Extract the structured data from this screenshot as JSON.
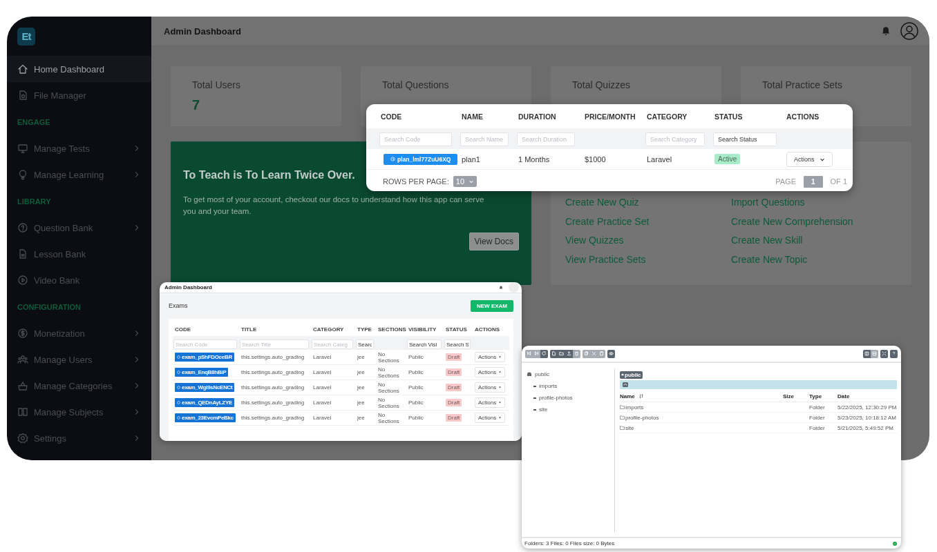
{
  "sidebar": {
    "logo": "Et",
    "items": [
      {
        "kind": "item",
        "label": "Home Dashboard",
        "selected": true,
        "submenu": false
      },
      {
        "kind": "item",
        "label": "File Manager",
        "selected": false,
        "submenu": false
      },
      {
        "kind": "section",
        "label": "ENGAGE"
      },
      {
        "kind": "item",
        "label": "Manage Tests",
        "selected": false,
        "submenu": true
      },
      {
        "kind": "item",
        "label": "Manage Learning",
        "selected": false,
        "submenu": true
      },
      {
        "kind": "section",
        "label": "LIBRARY"
      },
      {
        "kind": "item",
        "label": "Question Bank",
        "selected": false,
        "submenu": true
      },
      {
        "kind": "item",
        "label": "Lesson Bank",
        "selected": false,
        "submenu": false
      },
      {
        "kind": "item",
        "label": "Video Bank",
        "selected": false,
        "submenu": false
      },
      {
        "kind": "section",
        "label": "CONFIGURATION"
      },
      {
        "kind": "item",
        "label": "Monetization",
        "selected": false,
        "submenu": true
      },
      {
        "kind": "item",
        "label": "Manage Users",
        "selected": false,
        "submenu": true
      },
      {
        "kind": "item",
        "label": "Manage Categories",
        "selected": false,
        "submenu": true
      },
      {
        "kind": "item",
        "label": "Manage Subjects",
        "selected": false,
        "submenu": true
      },
      {
        "kind": "item",
        "label": "Settings",
        "selected": false,
        "submenu": true
      }
    ]
  },
  "header": {
    "title": "Admin Dashboard"
  },
  "stats": [
    {
      "label": "Total Users",
      "value": "7"
    },
    {
      "label": "Total Questions"
    },
    {
      "label": "Total Quizzes"
    },
    {
      "label": "Total Practice Sets"
    }
  ],
  "banner": {
    "title": "To Teach is To Learn Twice Over.",
    "text": "To get most of your account, checkout our docs to understand how this app can serve you and your team.",
    "button": "View Docs"
  },
  "quick_links": [
    "Create New Quiz",
    "Import Questions",
    "Create Practice Set",
    "Create New Comprehension",
    "View Quizzes",
    "Create New Skill",
    "View Practice Sets",
    "Create New Topic"
  ],
  "plans_table": {
    "columns": [
      {
        "label": "CODE",
        "filter": {
          "placeholder": "Search Code"
        }
      },
      {
        "label": "NAME",
        "filter": {
          "placeholder": "Search Name"
        }
      },
      {
        "label": "DURATION",
        "filter": {
          "placeholder": "Search Duration"
        }
      },
      {
        "label": "PRICE/MONTH"
      },
      {
        "label": "CATEGORY",
        "filter": {
          "placeholder": "Search Category"
        }
      },
      {
        "label": "STATUS",
        "filter": {
          "value": "Search Status"
        }
      },
      {
        "label": "ACTIONS"
      }
    ],
    "rows": [
      {
        "code": "plan_lml77ZuU6XQ",
        "name": "plan1",
        "duration": "1 Months",
        "price": "$1000",
        "category": "Laravel",
        "status": "Active",
        "color": "#a8ecc9",
        "action": "Actions"
      }
    ],
    "footer": {
      "rows_label": "ROWS PER PAGE:",
      "rows_value": "10",
      "page_label": "PAGE",
      "page": "1",
      "page_total": "OF 1"
    }
  },
  "exams_window": {
    "title": "Admin Dashboard",
    "heading": "Exams",
    "new_button": "NEW EXAM",
    "columns": [
      {
        "label": "CODE",
        "filter": {
          "placeholder": "Search Code"
        }
      },
      {
        "label": "TITLE",
        "filter": {
          "placeholder": "Search Title"
        }
      },
      {
        "label": "CATEGORY",
        "filter": {
          "placeholder": "Search Categ"
        }
      },
      {
        "label": "TYPE",
        "filter": {
          "value": "Searc"
        }
      },
      {
        "label": "SECTIONS"
      },
      {
        "label": "VISIBILITY",
        "filter": {
          "value": "Search Visi"
        }
      },
      {
        "label": "STATUS",
        "filter": {
          "value": "Search S"
        }
      },
      {
        "label": "ACTIONS"
      }
    ],
    "rows": [
      {
        "code": "exam_pShFDOceBR",
        "title": "this.settings.auto_grading",
        "category": "Laravel",
        "type": "jee",
        "sections": "No Sections",
        "visibility": "Public",
        "status": "Draft",
        "color": "#f9c9c9",
        "action": "Actions"
      },
      {
        "code": "exam_EnqB8hBiP",
        "title": "this.settings.auto_grading",
        "category": "Laravel",
        "type": "jee",
        "sections": "No Sections",
        "visibility": "Public",
        "status": "Draft",
        "color": "#f9c9c9",
        "action": "Actions"
      },
      {
        "code": "exam_WgI9sNcENCt",
        "title": "this.settings.auto_grading",
        "category": "Laravel",
        "type": "jee",
        "sections": "No Sections",
        "visibility": "Public",
        "status": "Draft",
        "color": "#f9c9c9",
        "action": "Actions"
      },
      {
        "code": "exam_QEDnAyLZYE",
        "title": "this.settings.auto_grading",
        "category": "Laravel",
        "type": "jee",
        "sections": "No Sections",
        "visibility": "Public",
        "status": "Draft",
        "color": "#f9c9c9",
        "action": "Actions"
      },
      {
        "code": "exam_23EvcmPeBkc",
        "title": "this.settings.auto_grading",
        "category": "Laravel",
        "type": "jee",
        "sections": "No Sections",
        "visibility": "Public",
        "status": "Draft",
        "color": "#f9c9c9",
        "action": "Actions"
      }
    ]
  },
  "file_manager": {
    "toolbar": {
      "left": [
        [
          {
            "disabled": true
          },
          {
            "disabled": true
          },
          {
            "disabled": false
          }
        ],
        [
          {
            "disabled": false
          },
          {
            "disabled": false
          },
          {
            "disabled": false
          },
          {
            "disabled": true
          }
        ],
        [
          {
            "disabled": true
          },
          {
            "disabled": true
          },
          {
            "disabled": true
          }
        ],
        [
          {
            "disabled": false
          }
        ]
      ],
      "right": [
        [
          {
            "disabled": false
          },
          {
            "disabled": true
          }
        ],
        [
          {
            "disabled": false
          }
        ],
        [
          {
            "disabled": false
          }
        ]
      ]
    },
    "tree": {
      "label": "public",
      "children": [
        {
          "label": "imports"
        },
        {
          "label": "profile-photos"
        },
        {
          "label": "site"
        }
      ]
    },
    "breadcrumb": "public",
    "columns": [
      "Name",
      "Size",
      "Type",
      "Date"
    ],
    "rows": [
      {
        "name": "imports",
        "type": "Folder",
        "date": "5/22/2025, 12:30:29 PM"
      },
      {
        "name": "profile-photos",
        "type": "Folder",
        "date": "5/23/2025, 10:18:12 AM"
      },
      {
        "name": "site",
        "type": "Folder",
        "date": "5/21/2025, 5:49:52 PM"
      }
    ],
    "status_text": "Folders: 3 Files: 0 Files size: 0 Bytes"
  }
}
